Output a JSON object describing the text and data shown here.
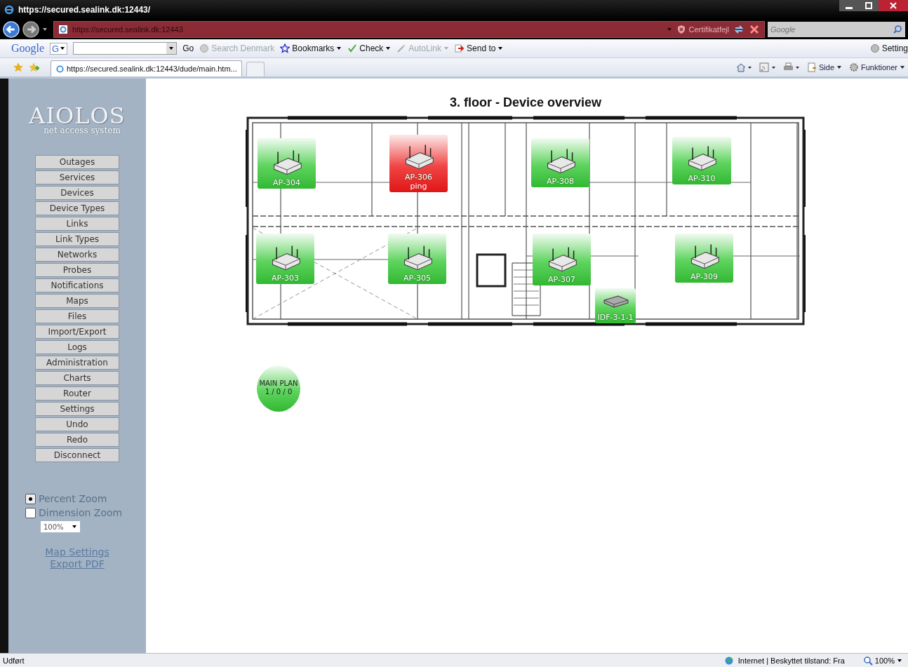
{
  "browser": {
    "title": "https://secured.sealink.dk:12443/",
    "address": "https://secured.sealink.dk:12443",
    "certificate_error": "Certifikatfejl",
    "search_placeholder": "Google"
  },
  "google_toolbar": {
    "logo": "Google",
    "search_letter": "G",
    "items": [
      {
        "label": "Go",
        "disabled": false,
        "kind": "plain"
      },
      {
        "label": "Search Denmark",
        "disabled": true,
        "kind": "globe"
      },
      {
        "label": "Bookmarks",
        "disabled": false,
        "kind": "star"
      },
      {
        "label": "Check",
        "disabled": false,
        "kind": "check"
      },
      {
        "label": "AutoLink",
        "disabled": true,
        "kind": "wand"
      },
      {
        "label": "Send to",
        "disabled": false,
        "kind": "send"
      }
    ],
    "settings": "Setting"
  },
  "tab": {
    "label": "https://secured.sealink.dk:12443/dude/main.htm..."
  },
  "command_bar": {
    "page": "Side",
    "tools": "Funktioner"
  },
  "sidebar": {
    "logo": "AIOLOS",
    "tagline": "net access system",
    "items": [
      "Outages",
      "Services",
      "Devices",
      "Device Types",
      "Links",
      "Link Types",
      "Networks",
      "Probes",
      "Notifications",
      "Maps",
      "Files",
      "Import/Export",
      "Logs",
      "Administration",
      "Charts",
      "Router",
      "Settings",
      "Undo",
      "Redo",
      "Disconnect"
    ],
    "zoom_options": [
      {
        "label": "Percent Zoom",
        "selected": true
      },
      {
        "label": "Dimension Zoom",
        "selected": false
      }
    ],
    "zoom_value": "100%",
    "links": [
      "Map Settings",
      "Export PDF"
    ]
  },
  "map": {
    "title": "3. floor - Device overview",
    "devices": [
      {
        "name": "AP-304",
        "kind": "ap",
        "down": false
      },
      {
        "name": "AP-306",
        "kind": "ap",
        "down": true,
        "problem": "ping"
      },
      {
        "name": "AP-308",
        "kind": "ap",
        "down": false
      },
      {
        "name": "AP-310",
        "kind": "ap",
        "down": false
      },
      {
        "name": "AP-303",
        "kind": "ap",
        "down": false
      },
      {
        "name": "AP-305",
        "kind": "ap",
        "down": false
      },
      {
        "name": "AP-307",
        "kind": "ap",
        "down": false
      },
      {
        "name": "AP-309",
        "kind": "ap",
        "down": false
      },
      {
        "name": "IDF-3-1-1",
        "kind": "switch",
        "down": false
      }
    ],
    "submap": {
      "label": "MAIN PLAN",
      "counts": "1 / 0 / 0",
      "down": false
    }
  },
  "status_bar": {
    "text": "Udført",
    "zone": "Internet | Beskyttet tilstand: Fra",
    "zoom": "100%"
  }
}
